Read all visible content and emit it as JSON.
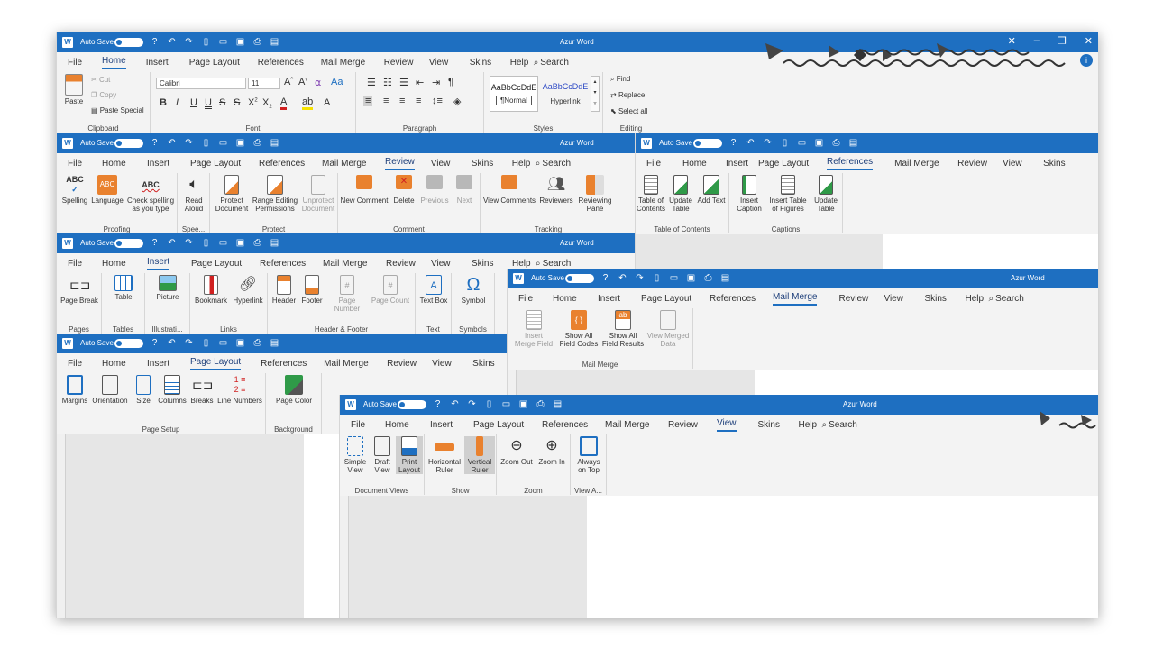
{
  "app": {
    "title": "Azur Word",
    "autosave_label": "Auto Save",
    "window_buttons": [
      "✕",
      "–",
      "❐",
      "✕"
    ]
  },
  "tabs": [
    "File",
    "Home",
    "Insert",
    "Page Layout",
    "References",
    "Mail Merge",
    "Review",
    "View",
    "Skins",
    "Help"
  ],
  "search_label": "Search",
  "home": {
    "clipboard": {
      "paste": "Paste",
      "cut": "Cut",
      "copy": "Copy",
      "paste_special": "Paste Special",
      "group": "Clipboard"
    },
    "font": {
      "name": "Calibri",
      "size": "11",
      "group": "Font"
    },
    "paragraph": {
      "group": "Paragraph"
    },
    "styles": {
      "normal_sample": "AaBbCcDdE",
      "normal_label": "¶Normal",
      "hyperlink_sample": "AaBbCcDdE",
      "hyperlink_label": "Hyperlink",
      "group": "Styles"
    },
    "editing": {
      "find": "Find",
      "replace": "Replace",
      "select_all": "Select all",
      "group": "Editing"
    }
  },
  "review": {
    "spelling": "Spelling",
    "language": "Language",
    "check_spelling": "Check spelling\nas you type",
    "proofing": "Proofing",
    "read_aloud": "Read\nAloud",
    "speech": "Spee...",
    "protect_document": "Protect\nDocument",
    "range_editing": "Range Editing\nPermissions",
    "unprotect_document": "Unprotect\nDocument",
    "protect": "Protect",
    "new_comment": "New Comment",
    "delete": "Delete",
    "previous": "Previous",
    "next": "Next",
    "comment": "Comment",
    "view_comments": "View Comments",
    "reviewers": "Reviewers",
    "reviewing_pane": "Reviewing\nPane",
    "tracking": "Tracking"
  },
  "references": {
    "toc": "Table of\nContents",
    "update_table": "Update\nTable",
    "add_text": "Add Text",
    "toc_group": "Table of Contents",
    "insert_caption": "Insert\nCaption",
    "insert_table_figures": "Insert Table\nof Figures",
    "update_table2": "Update\nTable",
    "captions": "Captions"
  },
  "insert": {
    "page_break": "Page Break",
    "pages": "Pages",
    "table": "Table",
    "tables": "Tables",
    "picture": "Picture",
    "illustrations": "Illustrati...",
    "bookmark": "Bookmark",
    "hyperlink": "Hyperlink",
    "links": "Links",
    "header": "Header",
    "footer": "Footer",
    "page_number": "Page Number",
    "page_count": "Page Count",
    "header_footer": "Header & Footer",
    "text_box": "Text Box",
    "text": "Text",
    "symbol": "Symbol",
    "symbols": "Symbols"
  },
  "mailmerge": {
    "insert_merge_field": "Insert\nMerge Field",
    "show_all_field_codes": "Show All\nField Codes",
    "show_all_field_results": "Show All\nField Results",
    "view_merged_data": "View Merged\nData",
    "group": "Mail Merge"
  },
  "pagelayout": {
    "margins": "Margins",
    "orientation": "Orientation",
    "size": "Size",
    "columns": "Columns",
    "breaks": "Breaks",
    "line_numbers": "Line Numbers",
    "page_setup": "Page Setup",
    "page_color": "Page Color",
    "background": "Background"
  },
  "view": {
    "simple_view": "Simple\nView",
    "draft_view": "Draft\nView",
    "print_layout": "Print\nLayout",
    "document_views": "Document Views",
    "horizontal_ruler": "Horizontal\nRuler",
    "vertical_ruler": "Vertical\nRuler",
    "show": "Show",
    "zoom_out": "Zoom Out",
    "zoom_in": "Zoom In",
    "zoom": "Zoom",
    "always_on_top": "Always\non Top",
    "view_a": "View A..."
  },
  "colors": {
    "titlebar": "#1e6fc1",
    "accent": "#1e6fc1",
    "orange": "#e9812e",
    "green": "#2f9a48"
  }
}
